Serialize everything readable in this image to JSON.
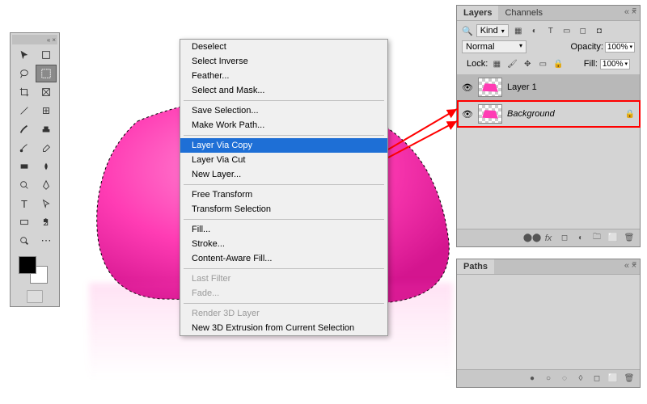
{
  "context_menu": {
    "items": [
      {
        "label": "Deselect",
        "disabled": false
      },
      {
        "label": "Select Inverse",
        "disabled": false
      },
      {
        "label": "Feather...",
        "disabled": false
      },
      {
        "label": "Select and Mask...",
        "disabled": false
      },
      {
        "sep": true
      },
      {
        "label": "Save Selection...",
        "disabled": false
      },
      {
        "label": "Make Work Path...",
        "disabled": false
      },
      {
        "sep": true
      },
      {
        "label": "Layer Via Copy",
        "highlight": true
      },
      {
        "label": "Layer Via Cut",
        "disabled": false
      },
      {
        "label": "New Layer...",
        "disabled": false
      },
      {
        "sep": true
      },
      {
        "label": "Free Transform",
        "disabled": false
      },
      {
        "label": "Transform Selection",
        "disabled": false
      },
      {
        "sep": true
      },
      {
        "label": "Fill...",
        "disabled": false
      },
      {
        "label": "Stroke...",
        "disabled": false
      },
      {
        "label": "Content-Aware Fill...",
        "disabled": false
      },
      {
        "sep": true
      },
      {
        "label": "Last Filter",
        "disabled": true
      },
      {
        "label": "Fade...",
        "disabled": true
      },
      {
        "sep": true
      },
      {
        "label": "Render 3D Layer",
        "disabled": true
      },
      {
        "label": "New 3D Extrusion from Current Selection",
        "disabled": false
      }
    ]
  },
  "layers_panel": {
    "tabs": [
      "Layers",
      "Channels"
    ],
    "active_tab": "Layers",
    "filter_label": "Kind",
    "blend_mode": "Normal",
    "opacity_label": "Opacity:",
    "opacity_value": "100%",
    "lock_label": "Lock:",
    "fill_label": "Fill:",
    "fill_value": "100%",
    "layers": [
      {
        "name": "Layer 1",
        "visible": true,
        "selected": true,
        "locked": false,
        "italic": false
      },
      {
        "name": "Background",
        "visible": true,
        "selected": false,
        "locked": true,
        "italic": true
      }
    ]
  },
  "paths_panel": {
    "tab": "Paths"
  },
  "colors": {
    "accent_pink": "#ff3cb4",
    "highlight_blue": "#1e6fd6",
    "callout_red": "#ff0000"
  }
}
